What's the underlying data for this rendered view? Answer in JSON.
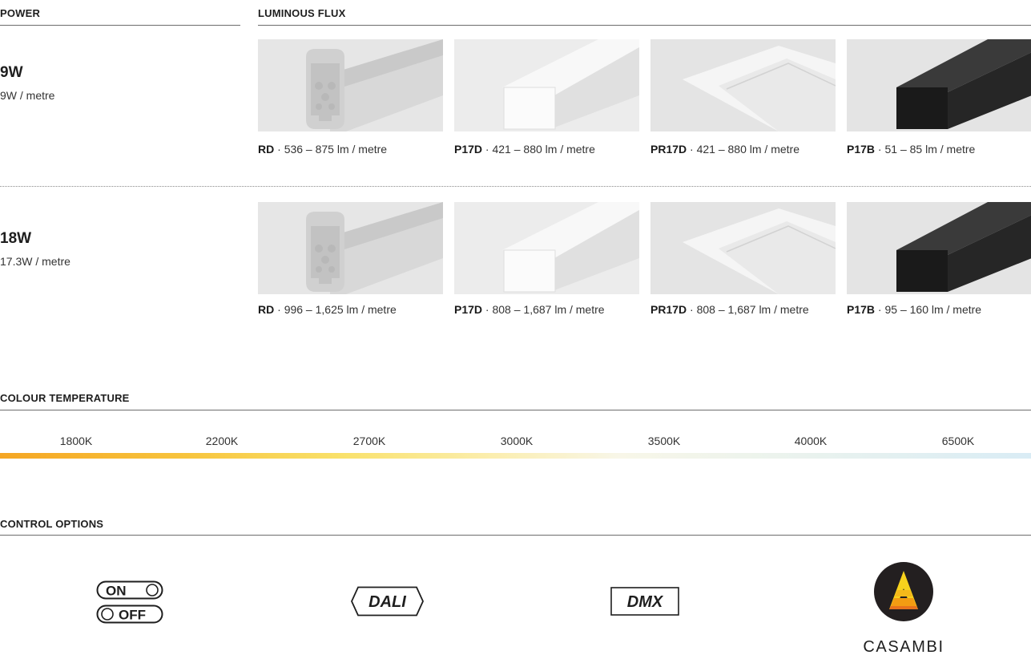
{
  "headers": {
    "power": "POWER",
    "flux": "LUMINOUS FLUX",
    "colour": "COLOUR TEMPERATURE",
    "control": "CONTROL OPTIONS"
  },
  "rows": [
    {
      "power": "9W",
      "sub": "9W / metre",
      "items": [
        {
          "code": "RD",
          "flux": "536 – 875 lm / metre"
        },
        {
          "code": "P17D",
          "flux": "421 – 880 lm / metre"
        },
        {
          "code": "PR17D",
          "flux": "421 – 880 lm / metre"
        },
        {
          "code": "P17B",
          "flux": "51 – 85 lm / metre"
        }
      ]
    },
    {
      "power": "18W",
      "sub": "17.3W / metre",
      "items": [
        {
          "code": "RD",
          "flux": "996 – 1,625 lm / metre"
        },
        {
          "code": "P17D",
          "flux": "808 – 1,687 lm / metre"
        },
        {
          "code": "PR17D",
          "flux": "808 – 1,687 lm / metre"
        },
        {
          "code": "P17B",
          "flux": "95 – 160 lm / metre"
        }
      ]
    }
  ],
  "sep": " · ",
  "temperatures": [
    "1800K",
    "2200K",
    "2700K",
    "3000K",
    "3500K",
    "4000K",
    "6500K"
  ],
  "controls": {
    "on": "ON",
    "off": "OFF",
    "dali": "DALI",
    "dmx": "DMX",
    "casambi": "CASAMBI"
  },
  "colors": {
    "gradient_start": "#f5a623",
    "gradient_end": "#d9ecf5",
    "casambi_orange": "#f39c12"
  },
  "icons": [
    "rd-profile-image",
    "p17d-profile-image",
    "pr17d-profile-image",
    "p17b-profile-image",
    "on-off-icon",
    "dali-icon",
    "dmx-icon",
    "casambi-logo"
  ]
}
